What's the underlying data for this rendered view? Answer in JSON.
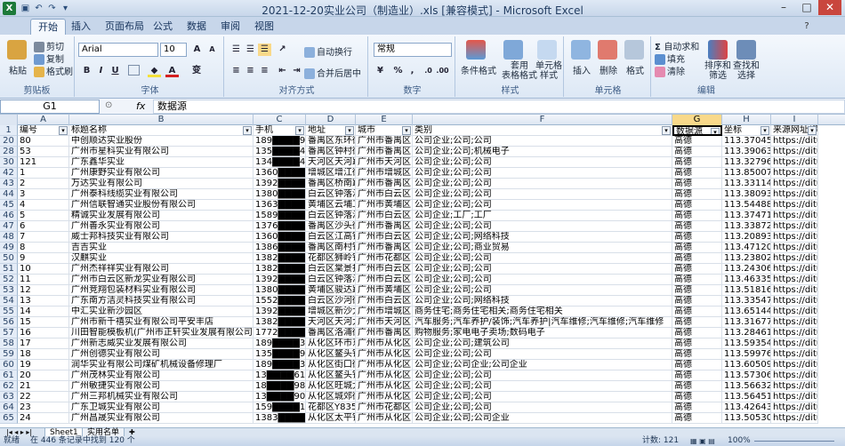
{
  "window": {
    "title": "2021-12-20实业公司（制造业）.xls  [兼容模式] - Microsoft Excel",
    "logo": "X"
  },
  "tabs": [
    "开始",
    "插入",
    "页面布局",
    "公式",
    "数据",
    "审阅",
    "视图"
  ],
  "ribbon": {
    "clipboard": {
      "paste": "粘贴",
      "cut": "剪切",
      "copy": "复制",
      "format_painter": "格式刷",
      "label": "剪贴板"
    },
    "font": {
      "name": "Arial",
      "size": "10",
      "grow": "A",
      "shrink": "A",
      "bold": "B",
      "italic": "I",
      "underline": "U",
      "wen": "变",
      "label": "字体"
    },
    "align": {
      "wrap": "自动换行",
      "merge": "合并后居中",
      "label": "对齐方式"
    },
    "number": {
      "format": "常规",
      "pct": "%",
      "comma": ",",
      "label": "数字"
    },
    "styles": {
      "cond": "条件格式",
      "table": "套用\n表格格式",
      "cell": "单元格\n样式",
      "label": "样式"
    },
    "cells": {
      "insert": "插入",
      "delete": "删除",
      "format": "格式",
      "label": "单元格"
    },
    "editing": {
      "autosum": "自动求和",
      "fill": "填充",
      "clear": "清除",
      "sort": "排序和\n筛选",
      "find": "查找和\n选择",
      "label": "编辑"
    }
  },
  "formula": {
    "namebox": "G1",
    "fx": "fx",
    "value": "数据源"
  },
  "columns": [
    "A",
    "B",
    "C",
    "D",
    "E",
    "F",
    "G",
    "H",
    "I"
  ],
  "header_row": {
    "num": "1",
    "cells": [
      "编号",
      "标题名称",
      "手机",
      "地址",
      "城市",
      "类别",
      "数据源",
      "坐标",
      "来源网址(请打"
    ]
  },
  "rows": [
    {
      "n": "20",
      "c": [
        "80",
        "中创顺达实业股份",
        "189████9055525",
        "番禺区东环街",
        "广州市番禺区",
        "公司企业;公司;公司",
        "高德",
        "113.370454,2",
        "https://ditu.amap"
      ]
    },
    {
      "n": "28",
      "c": [
        "53",
        "广州市星科实业有限公司",
        "135████40366",
        "番禺区钟村街",
        "广州市番禺区",
        "公司企业;公司;机械电子",
        "高德",
        "113.390631,2",
        "https://ditu.amap"
      ]
    },
    {
      "n": "30",
      "c": [
        "121",
        "广东鑫华实业",
        "134████44482",
        "天河区天河路",
        "广州市天河区",
        "公司企业;公司;公司",
        "高德",
        "113.327962,2",
        "https://ditu.amap"
      ]
    },
    {
      "n": "42",
      "c": [
        "1",
        "广州康野实业有限公司",
        "1360████72012",
        "增城区增江街",
        "广州市增城区",
        "公司企业;公司;公司",
        "高德",
        "113.85007,23",
        "https://ditu.amap"
      ]
    },
    {
      "n": "43",
      "c": [
        "2",
        "万达实业有限公司",
        "1392████28352",
        "番禺区桥南路",
        "广州市番禺区",
        "公司企业;公司;公司",
        "高德",
        "113.331148,2",
        "https://ditu.amap"
      ]
    },
    {
      "n": "44",
      "c": [
        "3",
        "广州泰科线缆实业有限公司",
        "1380████40807",
        "白云区钟落潭",
        "广州市白云区",
        "公司企业;公司;公司",
        "高德",
        "113.380931,2",
        "https://ditu.amap"
      ]
    },
    {
      "n": "45",
      "c": [
        "4",
        "广州信联智通实业股份有限公司",
        "1363████63119",
        "黄埔区云埔工",
        "广州市黄埔区",
        "公司企业;公司;公司",
        "高德",
        "113.544887,2",
        "https://ditu.amap"
      ]
    },
    {
      "n": "46",
      "c": [
        "5",
        "精诚实业发展有限公司",
        "1589████55378",
        "白云区钟落潭",
        "广州市白云区",
        "公司企业;工厂;工厂",
        "高德",
        "113.374713,2",
        "https://ditu.amap"
      ]
    },
    {
      "n": "47",
      "c": [
        "6",
        "广州善永实业有限公司",
        "1376████61002",
        "番禺区沙头街",
        "广州市番禺区",
        "公司企业;公司;公司",
        "高德",
        "113.338729,2",
        "https://ditu.amap"
      ]
    },
    {
      "n": "48",
      "c": [
        "7",
        "威士邦科技实业有限公司",
        "1360████76342",
        "白云区江高镇",
        "广州市白云区",
        "公司企业;公司;网络科技",
        "高德",
        "113.208934,2",
        "https://ditu.amap"
      ]
    },
    {
      "n": "49",
      "c": [
        "8",
        "吉吉实业",
        "1386████76369",
        "番禺区南村镇",
        "广州市番禺区",
        "公司企业;公司;商业贸易",
        "高德",
        "113.471208,2",
        "https://ditu.amap"
      ]
    },
    {
      "n": "50",
      "c": [
        "9",
        "汉麒实业",
        "1382████31659",
        "花都区狮岭镇",
        "广州市花都区",
        "公司企业;公司;公司",
        "高德",
        "113.238025,2",
        "https://ditu.amap"
      ]
    },
    {
      "n": "51",
      "c": [
        "10",
        "广州杰祥祥实业有限公司",
        "1382████41415",
        "白云区棠景打",
        "广州市白云区",
        "公司企业;公司;公司",
        "高德",
        "113.243061,2",
        "https://ditu.amap"
      ]
    },
    {
      "n": "52",
      "c": [
        "11",
        "广州市白云区新龙实业有限公司",
        "1392████56693",
        "白云区钟落潭",
        "广州市白云区",
        "公司企业;公司;公司",
        "高德",
        "113.463358,2",
        "https://ditu.amap"
      ]
    },
    {
      "n": "53",
      "c": [
        "12",
        "广州竞翔包装材料实业有限公司",
        "1380████87896",
        "黄埔区骏达路",
        "广州市黄埔区",
        "公司企业;公司;公司",
        "高德",
        "113.518162,2",
        "https://ditu.amap"
      ]
    },
    {
      "n": "54",
      "c": [
        "13",
        "广东南方洁灵科技实业有限公司",
        "1552████75471",
        "白云区沙河街",
        "广州市白云区",
        "公司企业;公司;网络科技",
        "高德",
        "113.335477,2",
        "https://ditu.amap"
      ]
    },
    {
      "n": "55",
      "c": [
        "14",
        "中汇实业新沙园区",
        "1392████03858",
        "增城区新沙大",
        "广州市增城区",
        "商务住宅;商务住宅相关;商务住宅相关",
        "高德",
        "113.651446,2",
        "https://ditu.amap"
      ]
    },
    {
      "n": "56",
      "c": [
        "15",
        "广州市新千禧实业有限公司平安丰店",
        "1382████14849",
        "天河区天河大",
        "广州市天河区",
        "汽车服务;汽车养护/装饰;汽车养护|汽车维修;汽车维修;汽车维修",
        "高德",
        "113.316779,2",
        "https://ditu.amap"
      ]
    },
    {
      "n": "57",
      "c": [
        "16",
        "川田智能模板机(广州市正轩实业发展有限公司)",
        "1772████50742",
        "番禺区洛浦街",
        "广州市番禺区",
        "购物服务;家电电子卖场;数码电子",
        "高德",
        "113.284612,2",
        "https://ditu.amap"
      ]
    },
    {
      "n": "58",
      "c": [
        "17",
        "广州新志威实业发展有限公司",
        "189████329898",
        "从化区环市东",
        "广州市从化区",
        "公司企业;公司;建筑公司",
        "高德",
        "113.59354,23",
        "https://ditu.amap"
      ]
    },
    {
      "n": "59",
      "c": [
        "18",
        "广州创德实业有限公司",
        "135████90121",
        "从化区鳌头镇",
        "广州市从化区",
        "公司企业;公司;公司",
        "高德",
        "113.599768,2",
        "https://ditu.amap"
      ]
    },
    {
      "n": "60",
      "c": [
        "19",
        "润华实业有限公司煤矿机械设备修理厂",
        "189████326881",
        "从化区街口街",
        "广州市从化区",
        "公司企业;公司企业;公司企业",
        "高德",
        "113.605094,2",
        "https://ditu.amap"
      ]
    },
    {
      "n": "61",
      "c": [
        "20",
        "广州茂林实业有限公司",
        "13████6122393",
        "从化区鳌头镇",
        "广州市从化区",
        "公司企业;公司;公司",
        "高德",
        "113.573062,2",
        "https://ditu.amap"
      ]
    },
    {
      "n": "62",
      "c": [
        "21",
        "广州敏捷实业有限公司",
        "18████9818283",
        "从化区旺城大",
        "广州市从化区",
        "公司企业;公司;公司",
        "高德",
        "113.566328,2",
        "https://ditu.amap"
      ]
    },
    {
      "n": "63",
      "c": [
        "22",
        "广州三邦机械实业有限公司",
        "13████9059011",
        "从化区城郊街",
        "广州市从化区",
        "公司企业;公司;公司",
        "高德",
        "113.564514,2",
        "https://ditu.amap"
      ]
    },
    {
      "n": "64",
      "c": [
        "23",
        "广东卫城实业有限公司",
        "159████184793",
        "花都区Y835县",
        "广州市花都区",
        "公司企业;公司;公司",
        "高德",
        "113.426439,2",
        "https://ditu.amap"
      ]
    },
    {
      "n": "65",
      "c": [
        "24",
        "广州昌晟实业有限公司",
        "1383████03001",
        "从化区太平镇",
        "广州市从化区",
        "公司企业;公司;公司企业",
        "高德",
        "113.505301,2",
        "https://ditu.amap"
      ]
    }
  ],
  "sheets": [
    "Sheet1",
    "实用名单"
  ],
  "status": {
    "ready": "就绪",
    "found": "在 446 条记录中找到 120 个",
    "count": "计数: 121",
    "zoom": "100%"
  }
}
